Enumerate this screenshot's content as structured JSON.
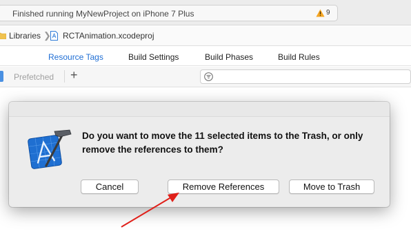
{
  "status": {
    "text": "Finished running MyNewProject on iPhone 7 Plus",
    "warning_count": "9",
    "icon": "warning-triangle-icon"
  },
  "breadcrumb": {
    "items": [
      "Libraries",
      "RCTAnimation.xcodeproj"
    ],
    "separator": "❯"
  },
  "tabs": [
    {
      "label": "Resource Tags",
      "active": true
    },
    {
      "label": "Build Settings",
      "active": false
    },
    {
      "label": "Build Phases",
      "active": false
    },
    {
      "label": "Build Rules",
      "active": false
    }
  ],
  "filterbar": {
    "prefetched_label": "Prefetched",
    "add_label": "+"
  },
  "dialog": {
    "message": "Do you want to move the 11 selected items to the Trash, or only remove the references to them?",
    "buttons": {
      "cancel": "Cancel",
      "remove_references": "Remove References",
      "move_to_trash": "Move to Trash"
    }
  },
  "colors": {
    "accent": "#1f6ed4",
    "annotation_arrow": "#e0201a",
    "warning": "#f5a623"
  }
}
